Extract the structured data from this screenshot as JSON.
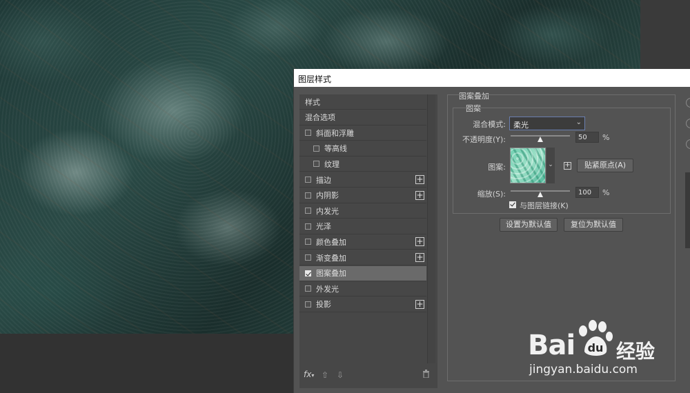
{
  "dialog": {
    "title": "图层样式",
    "style_list": [
      {
        "label": "样式",
        "checkbox": false,
        "checked": false,
        "plus": false,
        "indent": false,
        "selected": false
      },
      {
        "label": "混合选项",
        "checkbox": false,
        "checked": false,
        "plus": false,
        "indent": false,
        "selected": false
      },
      {
        "label": "斜面和浮雕",
        "checkbox": true,
        "checked": false,
        "plus": false,
        "indent": false,
        "selected": false
      },
      {
        "label": "等高线",
        "checkbox": true,
        "checked": false,
        "plus": false,
        "indent": true,
        "selected": false
      },
      {
        "label": "纹理",
        "checkbox": true,
        "checked": false,
        "plus": false,
        "indent": true,
        "selected": false
      },
      {
        "label": "描边",
        "checkbox": true,
        "checked": false,
        "plus": true,
        "indent": false,
        "selected": false
      },
      {
        "label": "内阴影",
        "checkbox": true,
        "checked": false,
        "plus": true,
        "indent": false,
        "selected": false
      },
      {
        "label": "内发光",
        "checkbox": true,
        "checked": false,
        "plus": false,
        "indent": false,
        "selected": false
      },
      {
        "label": "光泽",
        "checkbox": true,
        "checked": false,
        "plus": false,
        "indent": false,
        "selected": false
      },
      {
        "label": "颜色叠加",
        "checkbox": true,
        "checked": false,
        "plus": true,
        "indent": false,
        "selected": false
      },
      {
        "label": "渐变叠加",
        "checkbox": true,
        "checked": false,
        "plus": true,
        "indent": false,
        "selected": false
      },
      {
        "label": "图案叠加",
        "checkbox": true,
        "checked": true,
        "plus": false,
        "indent": false,
        "selected": true
      },
      {
        "label": "外发光",
        "checkbox": true,
        "checked": false,
        "plus": false,
        "indent": false,
        "selected": false
      },
      {
        "label": "投影",
        "checkbox": true,
        "checked": false,
        "plus": true,
        "indent": false,
        "selected": false
      }
    ],
    "footer": {
      "fx_label": "fx"
    },
    "panel": {
      "title": "图案叠加",
      "subtitle": "图案",
      "blend_mode_label": "混合模式:",
      "blend_mode_value": "柔光",
      "opacity_label": "不透明度(Y):",
      "opacity_value": "50",
      "opacity_level": 0.5,
      "percent": "%",
      "pattern_label": "图案:",
      "snap_origin_button": "贴紧原点(A)",
      "scale_label": "缩放(S):",
      "scale_value": "100",
      "scale_level": 0.5,
      "link_layer_label": "与图层链接(K)",
      "link_layer_checked": true,
      "set_default_button": "设置为默认值",
      "reset_default_button": "复位为默认值"
    }
  },
  "watermark": {
    "logo": "Bai",
    "logo_suffix": "经验",
    "url": "jingyan.baidu.com"
  }
}
